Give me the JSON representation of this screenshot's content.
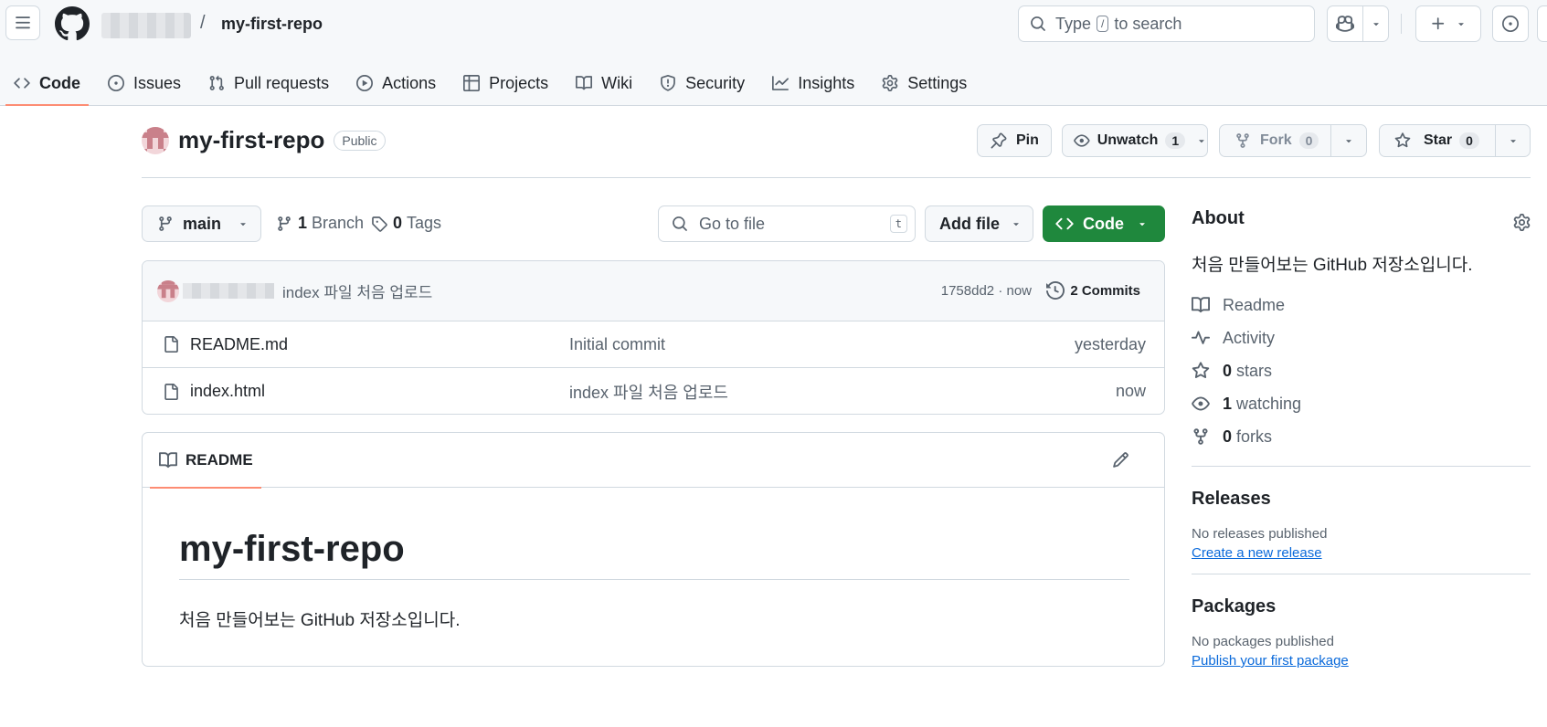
{
  "header": {
    "repo_name": "my-first-repo",
    "search_prefix": "Type",
    "search_key": "/",
    "search_suffix": "to search"
  },
  "tabs": [
    {
      "label": "Code",
      "icon": "code-icon",
      "active": true
    },
    {
      "label": "Issues",
      "icon": "issue-icon"
    },
    {
      "label": "Pull requests",
      "icon": "pull-request-icon"
    },
    {
      "label": "Actions",
      "icon": "play-icon"
    },
    {
      "label": "Projects",
      "icon": "table-icon"
    },
    {
      "label": "Wiki",
      "icon": "book-icon"
    },
    {
      "label": "Security",
      "icon": "shield-icon"
    },
    {
      "label": "Insights",
      "icon": "graph-icon"
    },
    {
      "label": "Settings",
      "icon": "gear-icon"
    }
  ],
  "repo": {
    "title": "my-first-repo",
    "visibility": "Public",
    "pin_label": "Pin",
    "unwatch_label": "Unwatch",
    "watch_count": "1",
    "fork_label": "Fork",
    "fork_count": "0",
    "star_label": "Star",
    "star_count": "0"
  },
  "toolbar": {
    "branch": "main",
    "branch_count": "1",
    "branch_label": "Branch",
    "tag_count": "0",
    "tag_label": "Tags",
    "goto_placeholder": "Go to file",
    "goto_key": "t",
    "add_file_label": "Add file",
    "code_label": "Code"
  },
  "commit": {
    "message": "index 파일 처음 업로드",
    "hash_time": "1758dd2 · now",
    "commits_label": "2 Commits"
  },
  "files": [
    {
      "name": "README.md",
      "message": "Initial commit",
      "time": "yesterday"
    },
    {
      "name": "index.html",
      "message": "index 파일 처음 업로드",
      "time": "now"
    }
  ],
  "readme": {
    "tab_label": "README",
    "heading": "my-first-repo",
    "body": "처음 만들어보는 GitHub 저장소입니다."
  },
  "about": {
    "title": "About",
    "description": "처음 만들어보는 GitHub 저장소입니다.",
    "readme_link": "Readme",
    "activity_link": "Activity",
    "stars_count": "0",
    "stars_label": "stars",
    "watching_count": "1",
    "watching_label": "watching",
    "forks_count": "0",
    "forks_label": "forks"
  },
  "releases": {
    "title": "Releases",
    "empty": "No releases published",
    "link": "Create a new release"
  },
  "packages": {
    "title": "Packages",
    "empty": "No packages published",
    "link": "Publish your first package"
  },
  "colors": {
    "accent_tab_underline": "#fd8c73",
    "code_button_green": "#1f883d",
    "link_blue": "#0969da"
  }
}
